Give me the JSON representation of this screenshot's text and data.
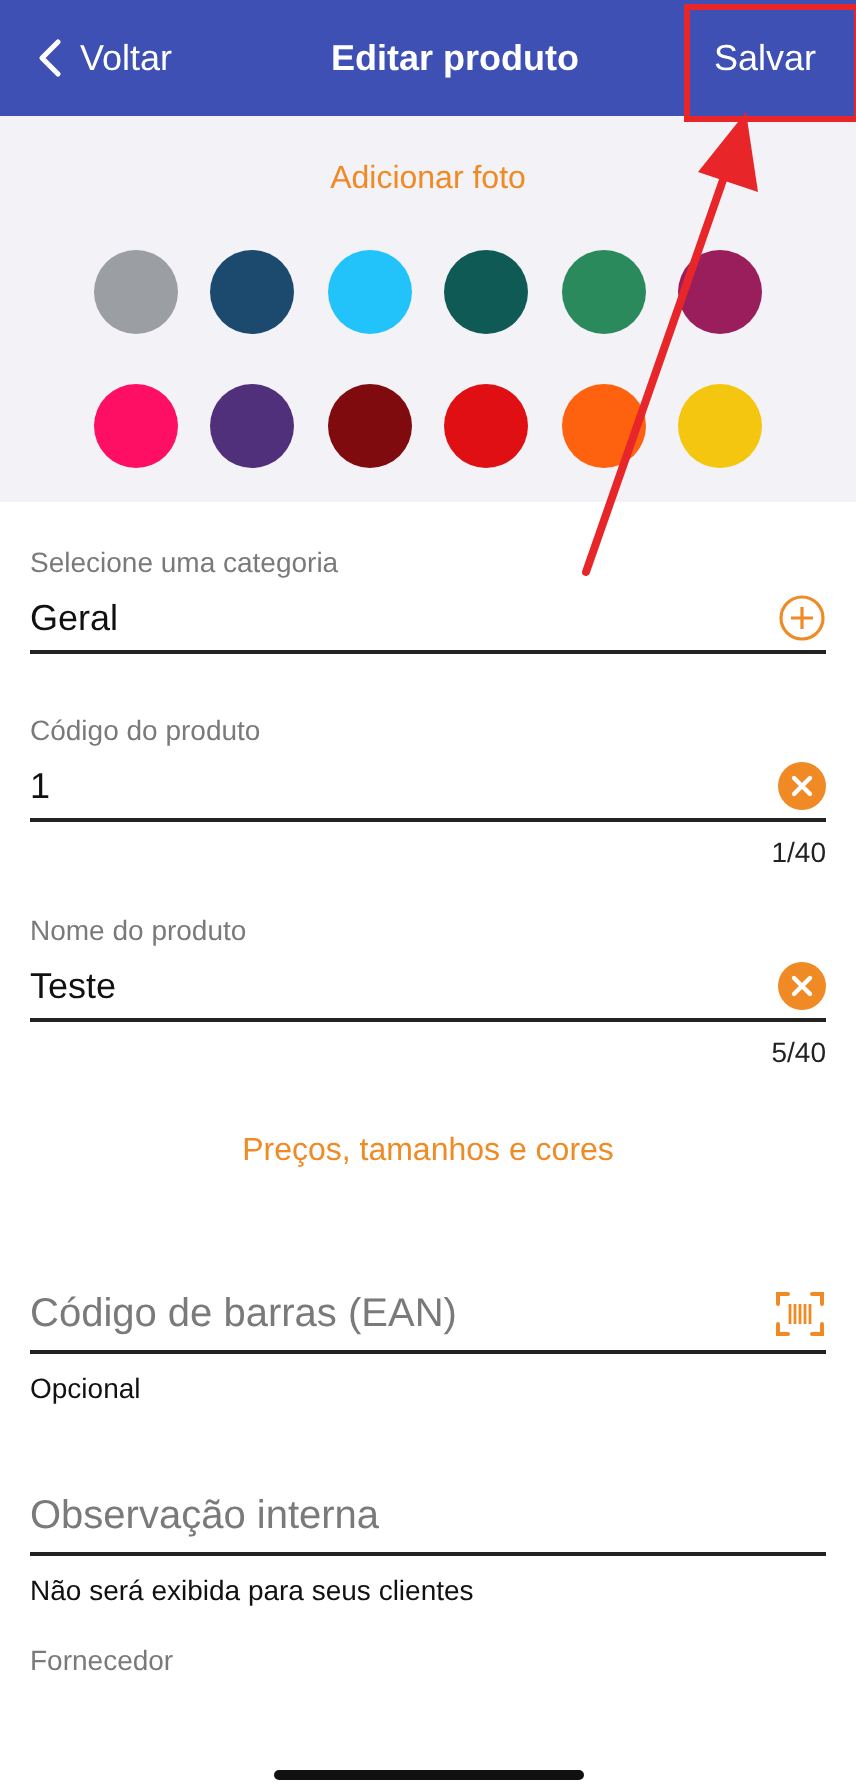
{
  "header": {
    "back": "Voltar",
    "title": "Editar produto",
    "save": "Salvar"
  },
  "photo": {
    "action": "Adicionar foto",
    "swatches": [
      {
        "color": "#9b9ea3"
      },
      {
        "color": "#1b4a6e"
      },
      {
        "color": "#22c3fb"
      },
      {
        "color": "#0f5a55"
      },
      {
        "color": "#2a8a5c"
      },
      {
        "color": "#9a1e5c"
      },
      {
        "color": "#fe0f63"
      },
      {
        "color": "#50307b"
      },
      {
        "color": "#800b0e"
      },
      {
        "color": "#e00f13"
      },
      {
        "color": "#fe620e"
      },
      {
        "color": "#f4c60f"
      }
    ]
  },
  "form": [
    {
      "kind": "select",
      "label": "Selecione uma categoria",
      "value": "Geral"
    },
    {
      "kind": "text",
      "label": "Código do produto",
      "value": "1",
      "counter": "1/40"
    },
    {
      "kind": "text",
      "label": "Nome do produto",
      "value": "Teste",
      "counter": "5/40"
    },
    {
      "kind": "link",
      "text": "Preços, tamanhos e cores"
    },
    {
      "kind": "barcode",
      "placeholder": "Código de barras (EAN)",
      "helper": "Opcional"
    },
    {
      "kind": "plain",
      "placeholder": "Observação interna",
      "helper": "Não será exibida para seus clientes"
    },
    {
      "kind": "label",
      "label": "Fornecedor"
    }
  ],
  "annotation": {
    "kind": "box-arrow"
  }
}
